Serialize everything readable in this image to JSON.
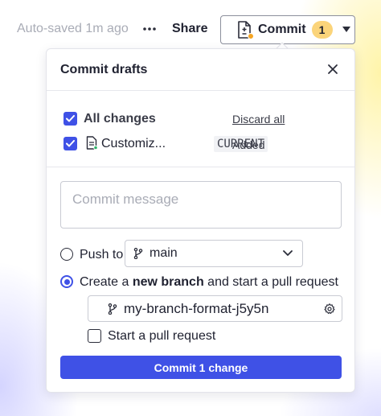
{
  "topbar": {
    "autosaved": "Auto-saved 1m ago",
    "more_icon": "ellipsis-icon",
    "share_label": "Share",
    "commit_label": "Commit",
    "commit_count": "1"
  },
  "panel": {
    "title": "Commit drafts",
    "all_changes_label": "All changes",
    "discard_all_label": "Discard all",
    "file": {
      "name": "Customiz...",
      "branch_badge": "CURRENT",
      "status": "Added"
    },
    "commit_message_placeholder": "Commit message",
    "push_to_label": "Push to",
    "push_branch_value": "main",
    "create_prefix": "Create a ",
    "create_bold": "new branch",
    "create_suffix": " and start a pull request",
    "new_branch_value": "my-branch-format-j5y5n",
    "start_pr_label": "Start a pull request",
    "commit_button_label": "Commit 1 change"
  },
  "colors": {
    "accent": "#3f51e6",
    "badge": "#fbd47a",
    "dot": "#f5a524"
  }
}
